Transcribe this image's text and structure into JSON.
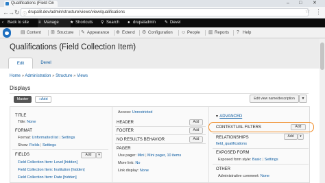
{
  "browser": {
    "tab_title": "Qualifications (Field Co",
    "url": "drupal8.dev/admin/structure/views/view/qualifications",
    "window_buttons": [
      "–",
      "□",
      "✕"
    ]
  },
  "toolbar": {
    "back_to_site": "Back to site",
    "manage": "Manage",
    "shortcuts": "Shortcuts",
    "search": "Search",
    "user": "drupaladmin",
    "devel": "Devel"
  },
  "admin_menu": [
    "Content",
    "Structure",
    "Appearance",
    "Extend",
    "Configuration",
    "People",
    "Reports",
    "Help"
  ],
  "page": {
    "title": "Qualifications (Field Collection Item)",
    "tabs": [
      "Edit",
      "Devel"
    ],
    "breadcrumb": [
      "Home",
      "Administration",
      "Structure",
      "Views"
    ],
    "breadcrumb_sep": "»",
    "displays_heading": "Displays",
    "master_label": "Master",
    "add_label": "+Add",
    "edit_view_label": "Edit view name/description"
  },
  "left_col": {
    "title_h": "TITLE",
    "title_line": "Title:",
    "title_value": "None",
    "format_h": "FORMAT",
    "format_label": "Format:",
    "format_value": "Unformatted list",
    "format_sep": "|",
    "format_settings": "Settings",
    "show_label": "Show:",
    "show_value": "Fields",
    "show_settings": "Settings",
    "fields_h": "FIELDS",
    "fields_add": "Add",
    "fields": [
      "Field Collection Item: Level [hidden]",
      "Field Collection Item: Institution [hidden]",
      "Field Collection Item: Date [hidden]"
    ]
  },
  "middle_col": {
    "access_label": "Access:",
    "access_value": "Unrestricted",
    "header_h": "HEADER",
    "footer_h": "FOOTER",
    "no_results_h": "NO RESULTS BEHAVIOR",
    "pager_h": "PAGER",
    "use_pager_label": "Use pager:",
    "use_pager_value": "Mini",
    "mini_pager_value": "Mini pager, 10 items",
    "more_link_label": "More link:",
    "more_link_value": "No",
    "link_display_label": "Link display:",
    "link_display_value": "None",
    "add_label": "Add"
  },
  "right_col": {
    "advanced": "ADVANCED",
    "contextual_filters": "CONTEXTUAL FILTERS",
    "relationships": "RELATIONSHIPS",
    "relationship_item": "field_qualifications",
    "exposed_form": "EXPOSED FORM",
    "exposed_form_style_label": "Exposed form style:",
    "exposed_form_style_value": "Basic",
    "exposed_form_settings": "Settings",
    "other": "OTHER",
    "admin_comment_label": "Administrative comment:",
    "admin_comment_value": "None",
    "add_label": "Add"
  },
  "colors": {
    "highlight_ring": "#f08a24",
    "link": "#0a5aa0",
    "toolbar_bg": "#0c0c0c"
  }
}
